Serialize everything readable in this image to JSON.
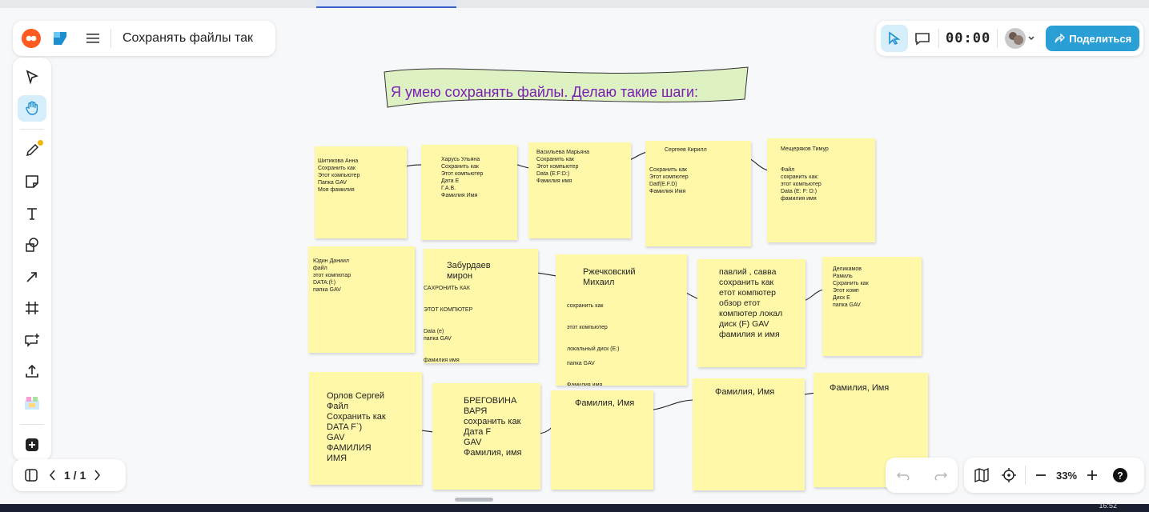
{
  "header": {
    "board_title": "Сохранять файлы так",
    "timer": "00:00",
    "share_label": "Поделиться"
  },
  "banner": {
    "text": "Я умею сохранять файлы. Делаю такие шаги:"
  },
  "stickies": [
    {
      "id": "n1",
      "text": "Шитикова Анна\nСохранить как\nЭтот компьютер\nПапка  GAV\nМоя фамилия"
    },
    {
      "id": "n2",
      "text": "Харусь Ульяна\nСохранить как\nЭтот компьютер\nДата Е\nГ.А.В.\nФамилия Имя"
    },
    {
      "id": "n3",
      "text": "Васильева Марьяна\nСохранить как\nЭтот компьютер\nData (E:F:D:)\nФамилия имя"
    },
    {
      "id": "n4a",
      "text": "Сергеев Кирилл"
    },
    {
      "id": "n4b",
      "text": "Сохранить как\nЭтот компютер\nDatf(E.F.D)\nФамилия Имя"
    },
    {
      "id": "n5a",
      "text": "Мещеряков Тимур"
    },
    {
      "id": "n5b",
      "text": "Файл\nсохранить как:\nэтот компьютер\nData (E: F: D:)\nфамилия имя"
    },
    {
      "id": "n6",
      "text": "Юдин Даниил\nфайл\nэтот компютар\nDATA:(f:)\n папка GAV"
    },
    {
      "id": "n7a",
      "text": "Забурдаев\nмирон"
    },
    {
      "id": "n7b",
      "text": "САХРОНИТЬ КАК\n\n\nЭТОТ КОМПЮТЕР\n\n\nData (e)\n     папка GAV\n\n\nфамилия имя"
    },
    {
      "id": "n8a",
      "text": "Ржечковский\nМихаил"
    },
    {
      "id": "n8b",
      "text": "сохранить как\n\n\nэтот компьютер\n\n\nлокальный диск (E:)\n\nпапка GAV\n\n\nФамилия имя"
    },
    {
      "id": "n9",
      "text": "павлий , савва\nсохранить как\nетот компютер\nобзор етот\nкомпютер локал\nдиск (F) GAV\nфамилия и имя"
    },
    {
      "id": "n10",
      "text": "Деликамов\nРамиль\nСjхранить как\nЭтот комп\nДиск Е\nпапка GAV"
    },
    {
      "id": "n11",
      "text": "Орлов Сергей\nФайл\nСохранить как\nDATA F`)\nGAV\nФАМИЛИЯ\nИМЯ"
    },
    {
      "id": "n12",
      "text": "БРЕГОВИНА\nВАРЯ\nсохранить как\nДата F\nGAV\nФамилия, имя"
    },
    {
      "id": "n13",
      "text": "Фамилия, Имя"
    },
    {
      "id": "n14",
      "text": "Фамилия, Имя"
    },
    {
      "id": "n15",
      "text": "Фамилия, Имя"
    }
  ],
  "pager": {
    "label": "1 / 1"
  },
  "zoom": {
    "label": "33%"
  },
  "taskbar": {
    "clock": "16:52"
  }
}
